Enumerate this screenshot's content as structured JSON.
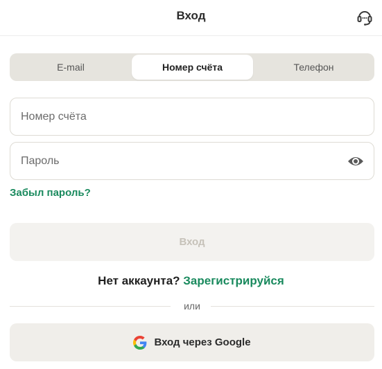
{
  "header": {
    "title": "Вход",
    "support_icon": "headset-icon"
  },
  "tabs": [
    {
      "label": "E-mail",
      "active": false
    },
    {
      "label": "Номер счёта",
      "active": true
    },
    {
      "label": "Телефон",
      "active": false
    }
  ],
  "form": {
    "account_field": {
      "placeholder": "Номер счёта",
      "value": ""
    },
    "password_field": {
      "placeholder": "Пароль",
      "value": "",
      "toggle_icon": "eye-icon"
    },
    "forgot_link": "Забыл пароль?",
    "login_button": "Вход"
  },
  "signup": {
    "question": "Нет аккаунта?",
    "link": "Зарегистрируйся"
  },
  "divider": {
    "label": "или"
  },
  "google": {
    "label": "Вход через Google",
    "icon": "google-icon"
  },
  "colors": {
    "accent": "#1a8a5e",
    "tabs_bg": "#e6e4de",
    "disabled_button_bg": "#f3f2ef",
    "disabled_button_text": "#c6c2b9",
    "google_button_bg": "#f0eeea"
  }
}
